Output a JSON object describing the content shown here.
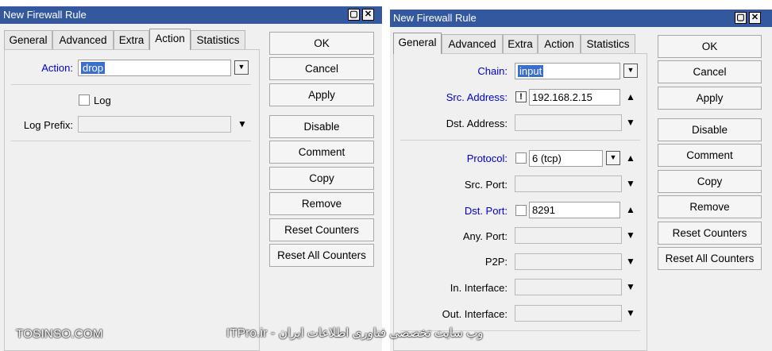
{
  "left_window": {
    "title": "New Firewall Rule",
    "tabs": [
      "General",
      "Advanced",
      "Extra",
      "Action",
      "Statistics"
    ],
    "active_tab": "Action",
    "action_label": "Action:",
    "action_value": "drop",
    "log_label": "Log",
    "log_prefix_label": "Log Prefix:",
    "log_prefix_value": "",
    "buttons": [
      "OK",
      "Cancel",
      "Apply",
      "Disable",
      "Comment",
      "Copy",
      "Remove",
      "Reset Counters",
      "Reset All Counters"
    ]
  },
  "right_window": {
    "title": "New Firewall Rule",
    "tabs": [
      "General",
      "Advanced",
      "Extra",
      "Action",
      "Statistics"
    ],
    "active_tab": "General",
    "fields": {
      "chain_label": "Chain:",
      "chain_value": "input",
      "src_address_label": "Src. Address:",
      "src_address_not": "!",
      "src_address_value": "192.168.2.15",
      "dst_address_label": "Dst. Address:",
      "protocol_label": "Protocol:",
      "protocol_value": "6 (tcp)",
      "src_port_label": "Src. Port:",
      "dst_port_label": "Dst. Port:",
      "dst_port_value": "8291",
      "any_port_label": "Any. Port:",
      "p2p_label": "P2P:",
      "in_interface_label": "In. Interface:",
      "out_interface_label": "Out. Interface:"
    },
    "buttons": [
      "OK",
      "Cancel",
      "Apply",
      "Disable",
      "Comment",
      "Copy",
      "Remove",
      "Reset Counters",
      "Reset All Counters"
    ]
  },
  "icons": {
    "dropdown": "dropdown-arrow-icon",
    "expand": "triangle-up-icon",
    "restore": "restore-window-icon",
    "close": "close-window-icon"
  },
  "colors": {
    "titlebar": "#33589e",
    "blue_label": "#0000d0",
    "selection": "#3a6fd0"
  },
  "watermark": {
    "left": "TOSINSO.COM",
    "center": "ITPro.ir - وب سایت تخصصی فناوری اطلاعات ایران"
  }
}
